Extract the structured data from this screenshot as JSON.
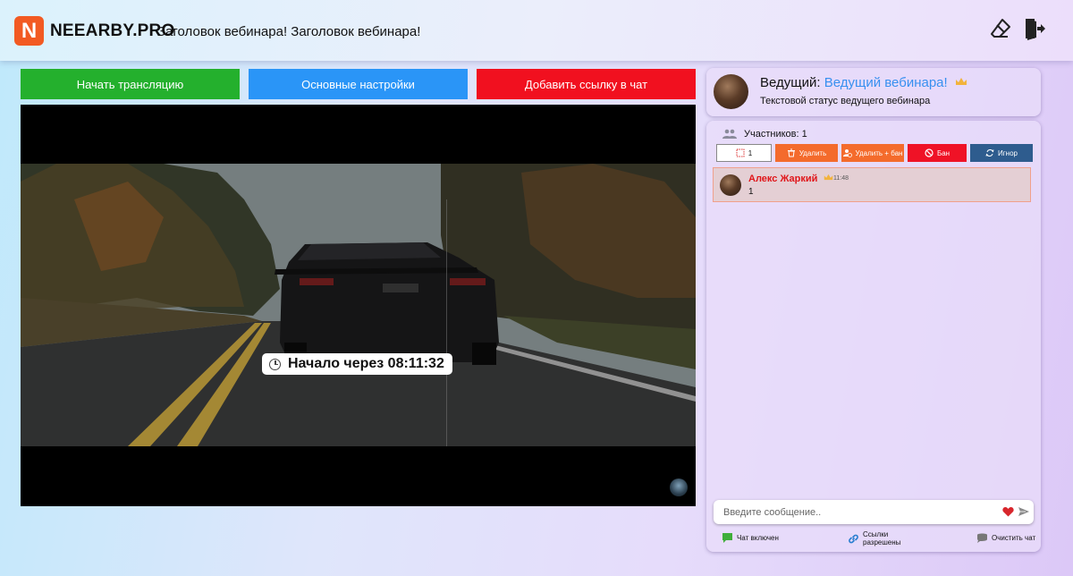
{
  "header": {
    "logo_letter": "N",
    "brand": "NEEARBY.PRO",
    "webinar_title": "Заголовок вебинара! Заголовок вебинара!"
  },
  "actions": {
    "start_broadcast": "Начать трансляцию",
    "main_settings": "Основные настройки",
    "add_link": "Добавить ссылку в чат"
  },
  "video": {
    "countdown": "Начало через 08:11:32"
  },
  "host": {
    "label": "Ведущий:",
    "name": "Ведущий вебинара!",
    "status": "Текстовой статус ведущего вебинара"
  },
  "chat": {
    "participants": "Участников: 1",
    "moderation": {
      "count": "1",
      "delete": "Удалить",
      "delete_ban": "Удалить + бан",
      "ban": "Бан",
      "ignore": "Игнор"
    },
    "messages": [
      {
        "author": "Алекс Жаркий",
        "time": "11:48",
        "text": "1"
      }
    ],
    "input_placeholder": "Введите сообщение..",
    "footer": {
      "chat_enabled": "Чат включен",
      "links_line1": "Ссылки",
      "links_line2": "разрешены",
      "clear_chat": "Очистить чат"
    }
  },
  "colors": {
    "brand": "#f25a22",
    "start_button": "#24b02d",
    "settings_button": "#2a95f7",
    "link_button": "#f1101f",
    "host_name": "#3890f0",
    "author": "#e0161a"
  }
}
